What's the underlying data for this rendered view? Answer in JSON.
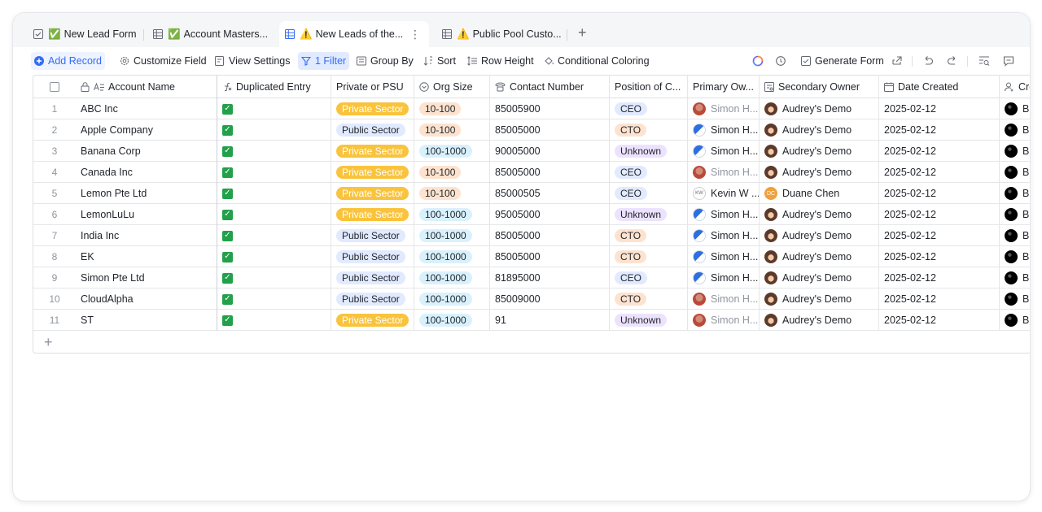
{
  "tabs": [
    {
      "label": "New Lead Form",
      "emoji": "✅"
    },
    {
      "label": "Account Masters...",
      "emoji": "✅"
    },
    {
      "label": "New Leads of the...",
      "emoji": "⚠️"
    },
    {
      "label": "Public Pool Custo...",
      "emoji": "⚠️"
    }
  ],
  "toolbar": {
    "add_record": "Add Record",
    "customize_field": "Customize Field",
    "view_settings": "View Settings",
    "filter": "1 Filter",
    "group_by": "Group By",
    "sort": "Sort",
    "row_height": "Row Height",
    "conditional_coloring": "Conditional Coloring",
    "generate_form": "Generate Form"
  },
  "columns": [
    "Account Name",
    "Duplicated Entry",
    "Private or PSU",
    "Org Size",
    "Contact Number",
    "Position of C...",
    "Primary Ow...",
    "Secondary Owner",
    "Date Created",
    "Cre"
  ],
  "rows": [
    {
      "n": "1",
      "name": "ABC Inc",
      "psu": "Private Sector",
      "org": "10-100",
      "contact": "85005900",
      "pos": "CEO",
      "primary": "Simon H...",
      "secondary": "Audrey's Demo",
      "date": "2025-02-12",
      "creator": "B"
    },
    {
      "n": "2",
      "name": "Apple Company",
      "psu": "Public Sector",
      "org": "10-100",
      "contact": "85005000",
      "pos": "CTO",
      "primary": "Simon H...",
      "secondary": "Audrey's Demo",
      "date": "2025-02-12",
      "creator": "B"
    },
    {
      "n": "3",
      "name": "Banana Corp",
      "psu": "Private Sector",
      "org": "100-1000",
      "contact": "90005000",
      "pos": "Unknown",
      "primary": "Simon H...",
      "secondary": "Audrey's Demo",
      "date": "2025-02-12",
      "creator": "B"
    },
    {
      "n": "4",
      "name": "Canada Inc",
      "psu": "Private Sector",
      "org": "10-100",
      "contact": "85005000",
      "pos": "CEO",
      "primary": "Simon H...",
      "secondary": "Audrey's Demo",
      "date": "2025-02-12",
      "creator": "B"
    },
    {
      "n": "5",
      "name": "Lemon Pte Ltd",
      "psu": "Private Sector",
      "org": "10-100",
      "contact": "85000505",
      "pos": "CEO",
      "primary": "Kevin W ...",
      "secondary": "Duane Chen",
      "date": "2025-02-12",
      "creator": "B"
    },
    {
      "n": "6",
      "name": "LemonLuLu",
      "psu": "Private Sector",
      "org": "100-1000",
      "contact": "95005000",
      "pos": "Unknown",
      "primary": "Simon H...",
      "secondary": "Audrey's Demo",
      "date": "2025-02-12",
      "creator": "B"
    },
    {
      "n": "7",
      "name": "India Inc",
      "psu": "Public Sector",
      "org": "100-1000",
      "contact": "85005000",
      "pos": "CTO",
      "primary": "Simon H...",
      "secondary": "Audrey's Demo",
      "date": "2025-02-12",
      "creator": "B"
    },
    {
      "n": "8",
      "name": "EK",
      "psu": "Public Sector",
      "org": "100-1000",
      "contact": "85005000",
      "pos": "CTO",
      "primary": "Simon H...",
      "secondary": "Audrey's Demo",
      "date": "2025-02-12",
      "creator": "B"
    },
    {
      "n": "9",
      "name": "Simon Pte Ltd",
      "psu": "Public Sector",
      "org": "100-1000",
      "contact": "81895000",
      "pos": "CEO",
      "primary": "Simon H...",
      "secondary": "Audrey's Demo",
      "date": "2025-02-12",
      "creator": "B"
    },
    {
      "n": "10",
      "name": "CloudAlpha",
      "psu": "Public Sector",
      "org": "100-1000",
      "contact": "85009000",
      "pos": "CTO",
      "primary": "Simon H...",
      "secondary": "Audrey's Demo",
      "date": "2025-02-12",
      "creator": "B"
    },
    {
      "n": "11",
      "name": "ST",
      "psu": "Private Sector",
      "org": "100-1000",
      "contact": "91",
      "pos": "Unknown",
      "primary": "Simon H...",
      "secondary": "Audrey's Demo",
      "date": "2025-02-12",
      "creator": "B"
    }
  ],
  "colors": {
    "accent": "#336df4",
    "private_tag": "#f9c33c",
    "check": "#22a04a"
  }
}
